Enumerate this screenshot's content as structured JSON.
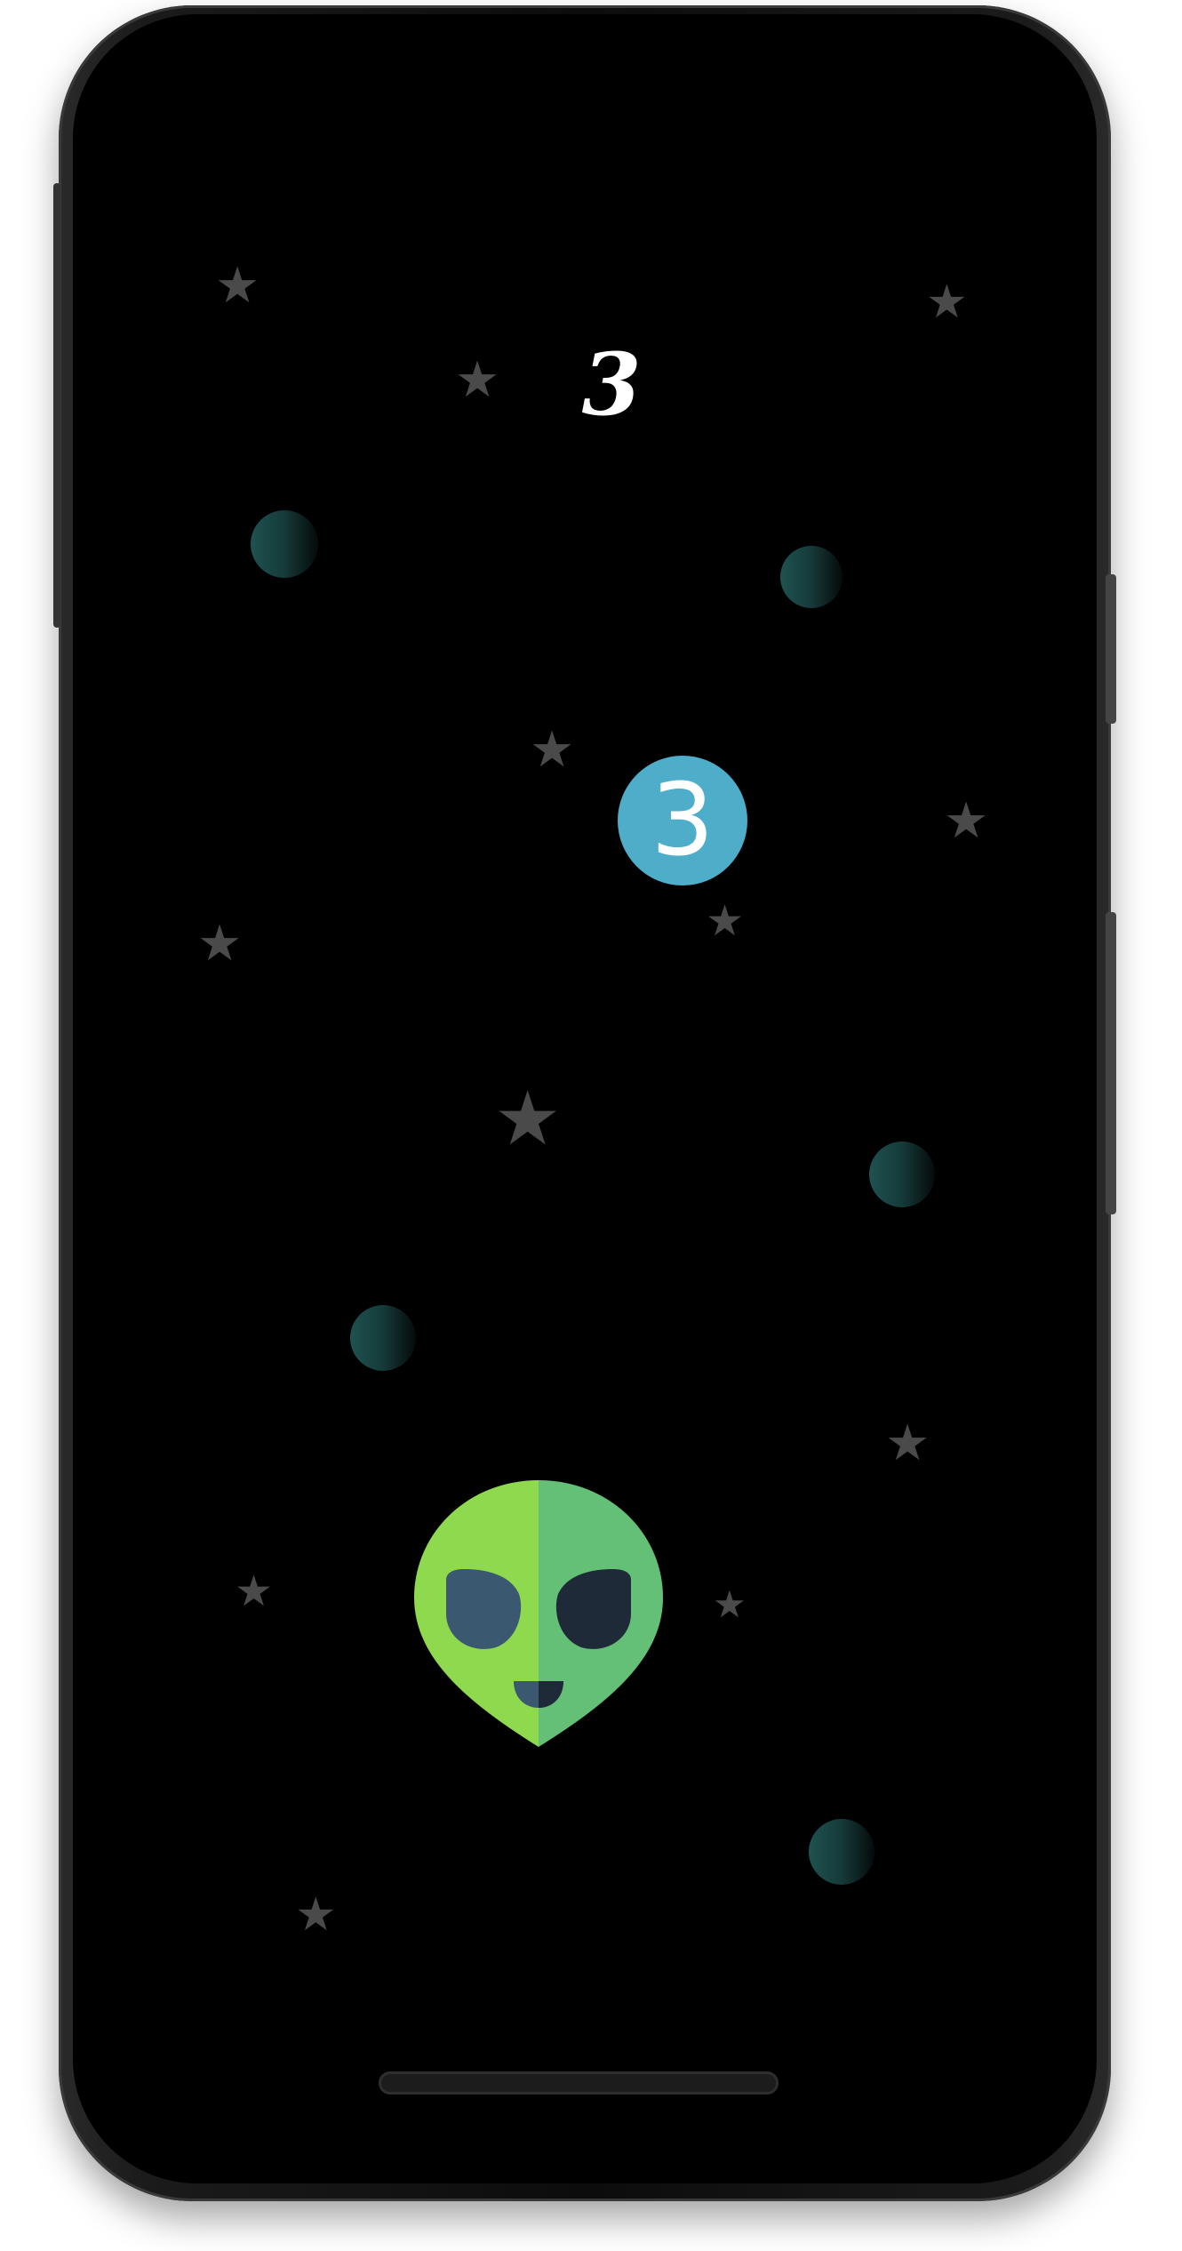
{
  "game": {
    "score": "3",
    "target_number": "3"
  },
  "icons": {
    "player": "alien-head-icon",
    "background_star": "star-icon",
    "background_planet": "planet-icon"
  },
  "colors": {
    "background": "#000000",
    "star": "#4a4a4a",
    "target_bubble": "#4eadc9",
    "alien_light": "#8fd94f",
    "alien_dark": "#64bf77",
    "alien_eye": "#3a5870",
    "alien_eye_dark": "#1e2a38",
    "planet": "#1f5250"
  }
}
